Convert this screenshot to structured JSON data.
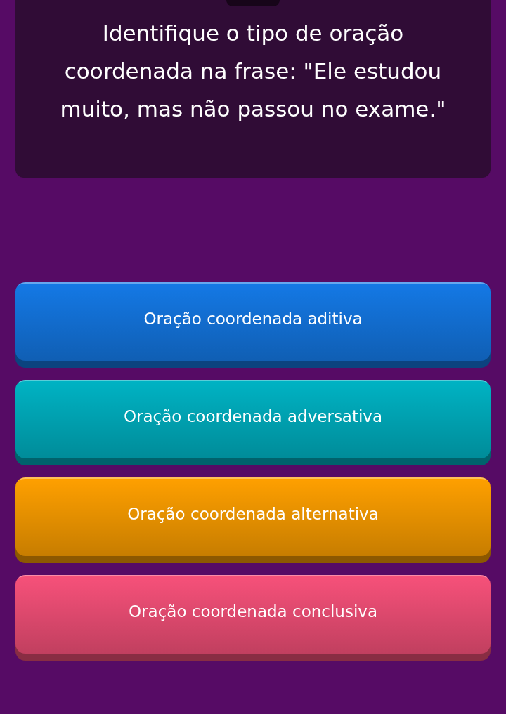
{
  "question": "Identifique o tipo de oração coordenada na frase: \"Ele estudou muito, mas não passou no exame.\"",
  "options": [
    {
      "label": "Oração coordenada aditiva",
      "color": "#1479e6"
    },
    {
      "label": "Oração coordenada adversativa",
      "color": "#00b3c4"
    },
    {
      "label": "Oração coordenada alternativa",
      "color": "#ffa000"
    },
    {
      "label": "Oração coordenada conclusiva",
      "color": "#f7517a"
    }
  ]
}
